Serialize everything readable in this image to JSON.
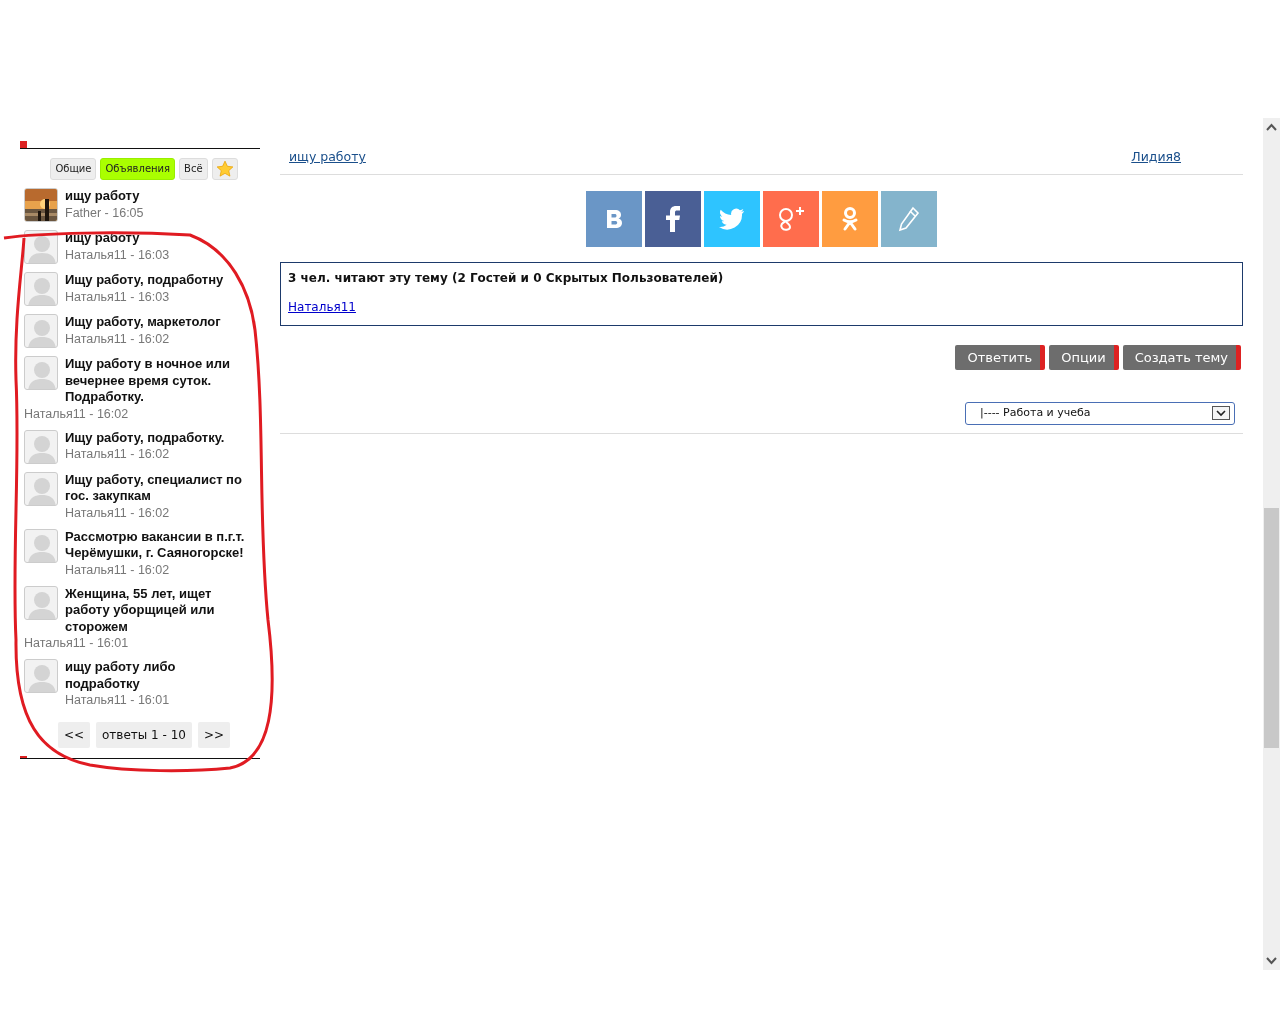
{
  "sidebar": {
    "tabs": [
      {
        "label": "Общие",
        "selected": false
      },
      {
        "label": "Объявления",
        "selected": true
      },
      {
        "label": "Всё",
        "selected": false
      }
    ],
    "topics": [
      {
        "title": "ищу работу",
        "meta": "Father - 16:05"
      },
      {
        "title": "ищу работу",
        "meta": "Наталья11 - 16:03",
        "kind": "default"
      },
      {
        "title": "Ищу работу, подработну",
        "meta": "Наталья11 - 16:03",
        "kind": "default"
      },
      {
        "title": "Ищу работу, маркетолог",
        "meta": "Наталья11 - 16:02",
        "kind": "default"
      },
      {
        "title": "Ищу работу в ночное или вечернее время суток. Подработку.",
        "meta": "Наталья11 - 16:02",
        "kind": "default"
      },
      {
        "title": "Ищу работу, подработку.",
        "meta": "Наталья11 - 16:02",
        "kind": "default"
      },
      {
        "title": "Ищу работу, специалист по гос. закупкам",
        "meta": "Наталья11 - 16:02",
        "kind": "default"
      },
      {
        "title": "Рассмотрю вакансии в п.г.т. Черёмушки, г. Саяногорске!",
        "meta": "Наталья11 - 16:02",
        "kind": "default"
      },
      {
        "title": "Женщина, 55 лет, ищет работу уборщицей или сторожем",
        "meta": "Наталья11 - 16:01",
        "kind": "default"
      },
      {
        "title": "ищу работу либо подработку",
        "meta": "Наталья11 - 16:01",
        "kind": "default"
      }
    ],
    "pagination": {
      "prev": "<<",
      "label": "ответы 1 - 10",
      "next": ">>"
    }
  },
  "main": {
    "topic_link": "ищу работу",
    "author_link": "Лидия8",
    "share_buttons": [
      {
        "kind": "vk"
      },
      {
        "kind": "facebook"
      },
      {
        "kind": "twitter"
      },
      {
        "kind": "googleplus"
      },
      {
        "kind": "odnoklassniki"
      },
      {
        "kind": "edit"
      }
    ],
    "readers": {
      "heading": "3 чел. читают эту тему (2 Гостей и 0 Скрытых Пользователей)",
      "users": [
        "Наталья11"
      ]
    },
    "actions": [
      "Ответить",
      "Опции",
      "Создать тему"
    ],
    "forum_select": {
      "value": "|---- Работа и учеба"
    }
  }
}
